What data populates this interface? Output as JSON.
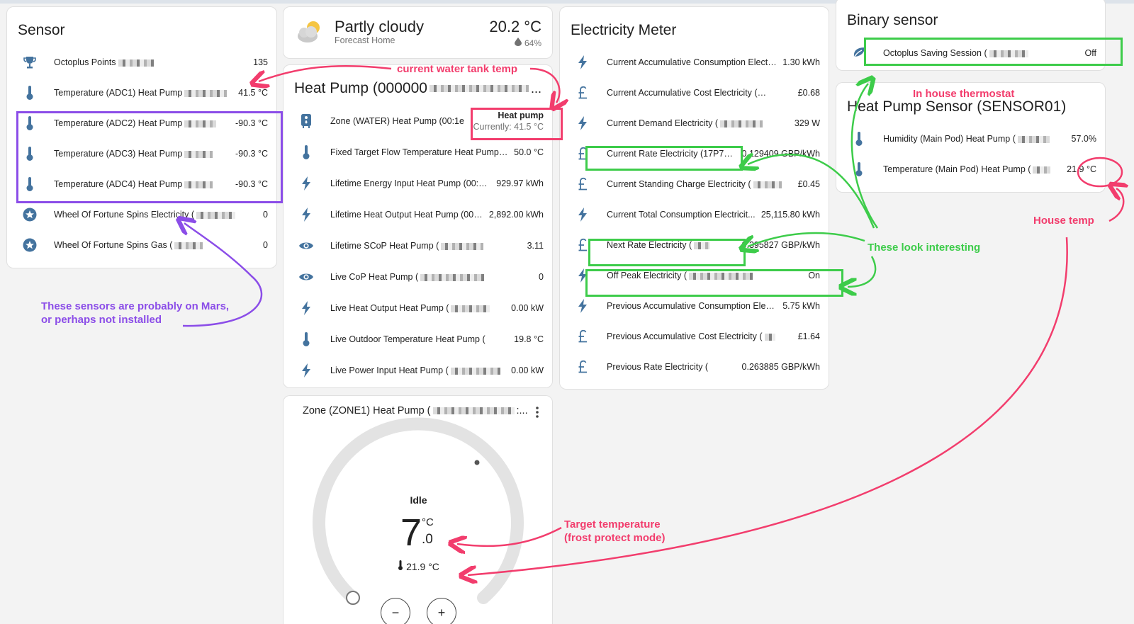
{
  "colors": {
    "icon_blue": "#44739e",
    "annot_pink": "#f23d6d",
    "annot_green": "#3dcc4a",
    "annot_purple": "#8b4de8",
    "dial_track": "#e3e3e3"
  },
  "sensor": {
    "title": "Sensor",
    "items": [
      {
        "icon": "trophy-icon",
        "label": "Octoplus Points",
        "value": "135"
      },
      {
        "icon": "thermometer-icon",
        "label": "Temperature (ADC1) Heat Pump",
        "value": "41.5 °C"
      },
      {
        "icon": "thermometer-icon",
        "label": "Temperature (ADC2) Heat Pump",
        "value": "-90.3 °C"
      },
      {
        "icon": "thermometer-icon",
        "label": "Temperature (ADC3) Heat Pump",
        "value": "-90.3 °C"
      },
      {
        "icon": "thermometer-icon",
        "label": "Temperature (ADC4) Heat Pump",
        "value": "-90.3 °C"
      },
      {
        "icon": "star-circle-icon",
        "label": "Wheel Of Fortune Spins Electricity (",
        "value": "0"
      },
      {
        "icon": "star-circle-icon",
        "label": "Wheel Of Fortune Spins Gas (",
        "value": "0"
      }
    ]
  },
  "weather": {
    "condition": "Partly cloudy",
    "location": "Forecast Home",
    "temperature": "20.2 °C",
    "humidity": "64%",
    "icon": "partly-cloudy-icon"
  },
  "heat_pump": {
    "title": "Heat Pump (000000",
    "items": [
      {
        "icon": "water-heater-icon",
        "label": "Zone (WATER) Heat Pump (00:1e",
        "value": "Heat pump",
        "sub": "Currently: 41.5 °C"
      },
      {
        "icon": "thermometer-icon",
        "label": "Fixed Target Flow Temperature Heat Pump (...",
        "value": "50.0 °C"
      },
      {
        "icon": "flash-icon",
        "label": "Lifetime Energy Input Heat Pump (00:1...",
        "value": "929.97 kWh"
      },
      {
        "icon": "flash-icon",
        "label": "Lifetime Heat Output Heat Pump (00:...",
        "value": "2,892.00 kWh"
      },
      {
        "icon": "eye-icon",
        "label": "Lifetime SCoP Heat Pump (",
        "value": "3.11"
      },
      {
        "icon": "eye-icon",
        "label": "Live CoP Heat Pump (",
        "value": "0"
      },
      {
        "icon": "flash-icon",
        "label": "Live Heat Output Heat Pump (",
        "value": "0.00 kW"
      },
      {
        "icon": "thermometer-icon",
        "label": "Live Outdoor Temperature Heat Pump (",
        "value": "19.8 °C"
      },
      {
        "icon": "flash-icon",
        "label": "Live Power Input Heat Pump (",
        "value": "0.00 kW"
      }
    ]
  },
  "thermostat": {
    "title": "Zone (ZONE1) Heat Pump (",
    "title_suffix": ":...",
    "status": "Idle",
    "target_whole": "7",
    "target_decimal": ".0",
    "target_unit": "°C",
    "current": "21.9 °C",
    "minus_label": "−",
    "plus_label": "+"
  },
  "electricity": {
    "title": "Electricity Meter",
    "items": [
      {
        "icon": "flash-icon",
        "label": "Current Accumulative Consumption Electr...",
        "value": "1.30 kWh"
      },
      {
        "icon": "currency-gbp-icon",
        "label": "Current Accumulative Cost Electricity (",
        "value": "£0.68"
      },
      {
        "icon": "flash-icon",
        "label": "Current Demand Electricity (",
        "value": "329 W"
      },
      {
        "icon": "currency-gbp-icon",
        "label": "Current Rate Electricity (17P71...",
        "value": "0.129409 GBP/kWh"
      },
      {
        "icon": "currency-gbp-icon",
        "label": "Current Standing Charge Electricity (",
        "value": "£0.45"
      },
      {
        "icon": "flash-icon",
        "label": "Current Total Consumption Electricit...",
        "value": "25,115.80 kWh"
      },
      {
        "icon": "currency-gbp-icon",
        "label": "Next Rate Electricity (",
        "value": "0.395827 GBP/kWh"
      },
      {
        "icon": "flash-icon",
        "label": "Off Peak Electricity (",
        "value": "On"
      },
      {
        "icon": "flash-icon",
        "label": "Previous Accumulative Consumption Elec...",
        "value": "5.75 kWh"
      },
      {
        "icon": "currency-gbp-icon",
        "label": "Previous Accumulative Cost Electricity (",
        "value": "£1.64"
      },
      {
        "icon": "currency-gbp-icon",
        "label": "Previous Rate Electricity (",
        "value": "0.263885 GBP/kWh"
      }
    ]
  },
  "binary": {
    "title": "Binary sensor",
    "items": [
      {
        "icon": "leaf-icon",
        "label": "Octoplus Saving Session (",
        "value": "Off"
      }
    ]
  },
  "hp_sensor": {
    "title": "Heat Pump Sensor (SENSOR01)",
    "items": [
      {
        "icon": "thermometer-icon",
        "label": "Humidity (Main Pod) Heat Pump (",
        "value": "57.0%"
      },
      {
        "icon": "thermometer-icon",
        "label": "Temperature (Main Pod) Heat Pump (",
        "value": "21.9 °C"
      }
    ]
  },
  "annotations": {
    "water_tank": "current water tank temp",
    "mars_line1": "These sensors are probably on Mars,",
    "mars_line2": "or perhaps not installed",
    "interesting": "These look interesting",
    "in_house": "In house thermostat",
    "house_temp": "House temp",
    "target_line1": "Target temperature",
    "target_line2": "(frost protect mode)"
  }
}
